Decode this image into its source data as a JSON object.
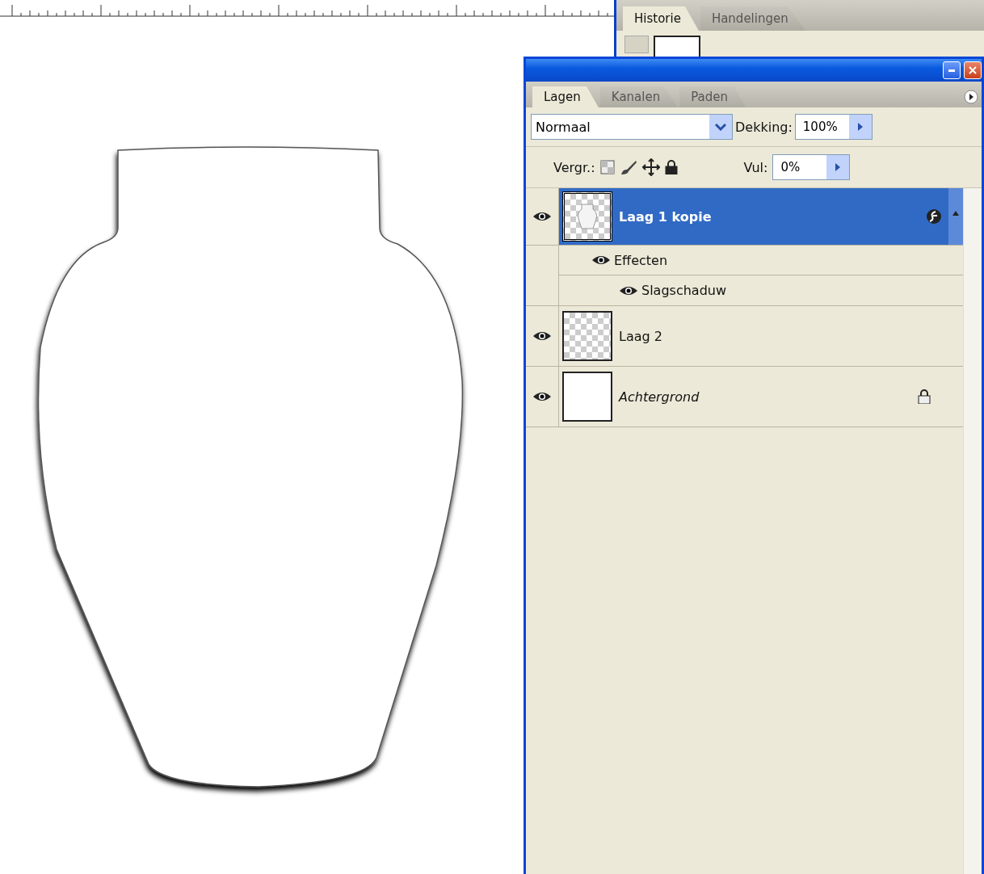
{
  "history_panel": {
    "tabs": [
      {
        "label": "Historie",
        "selected": true
      },
      {
        "label": "Handelingen",
        "selected": false
      }
    ]
  },
  "layers_panel": {
    "tabs": [
      {
        "label": "Lagen",
        "selected": true
      },
      {
        "label": "Kanalen",
        "selected": false
      },
      {
        "label": "Paden",
        "selected": false
      }
    ],
    "blend_mode": "Normaal",
    "opacity_label": "Dekking:",
    "opacity": "100%",
    "lock_label": "Vergr.:",
    "fill_label": "Vul:",
    "fill": "0%",
    "layers": [
      {
        "kind": "layer",
        "name": "Laag 1 kopie",
        "selected": true,
        "visible": true,
        "transparent": true,
        "has_content": true,
        "has_effects": true,
        "locked": false,
        "children": [
          {
            "name": "Effecten",
            "visible": true,
            "children": [
              {
                "name": "Slagschaduw",
                "visible": true
              }
            ]
          }
        ]
      },
      {
        "kind": "layer",
        "name": "Laag 2",
        "selected": false,
        "visible": true,
        "transparent": true,
        "has_content": false,
        "has_effects": false,
        "locked": false
      },
      {
        "kind": "background",
        "name": "Achtergrond",
        "selected": false,
        "visible": true,
        "transparent": false,
        "has_content": false,
        "has_effects": false,
        "locked": true
      }
    ]
  }
}
